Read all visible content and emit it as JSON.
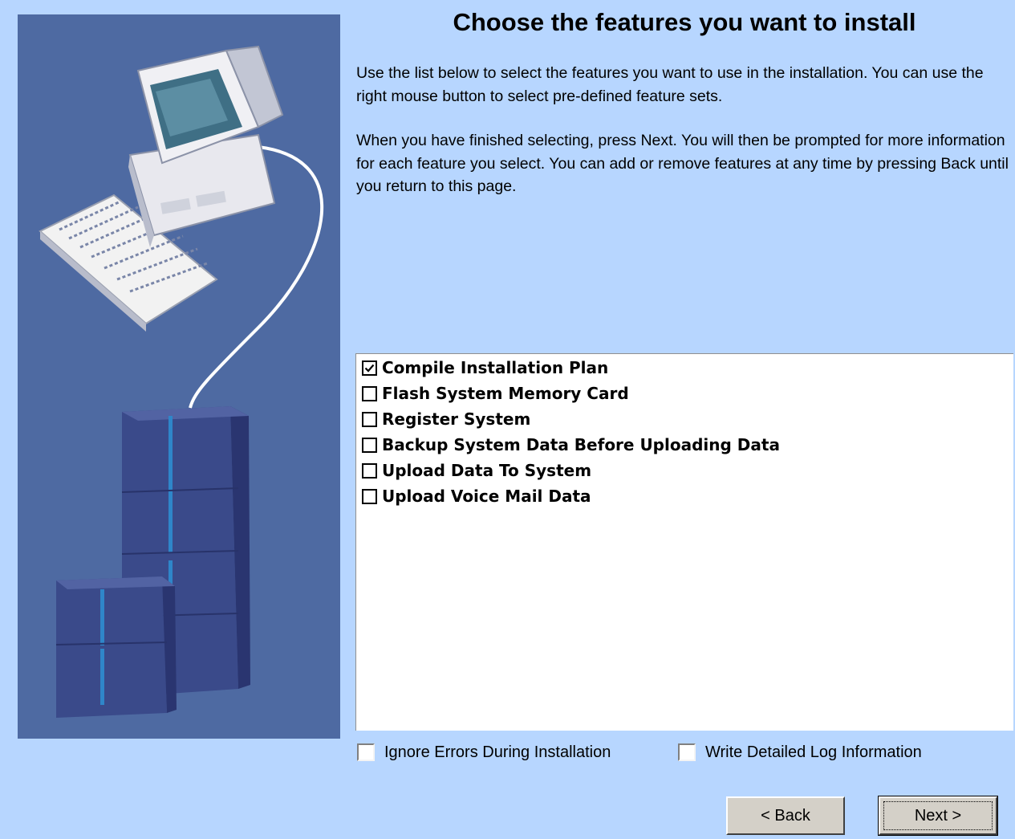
{
  "window": {
    "title": "Choose the features you want to install"
  },
  "description": {
    "paragraph1": "Use the list below to select the features you want to use in the installation. You can use the right mouse button to select pre-defined feature sets.",
    "paragraph2": "When you have finished selecting, press Next. You will then be prompted for more information for each feature you select. You can add or remove features at any time by pressing Back until you return to this page."
  },
  "features": [
    {
      "label": "Compile Installation Plan",
      "checked": true
    },
    {
      "label": "Flash System Memory Card",
      "checked": false
    },
    {
      "label": "Register System",
      "checked": false
    },
    {
      "label": "Backup System Data Before Uploading Data",
      "checked": false
    },
    {
      "label": "Upload Data To System",
      "checked": false
    },
    {
      "label": "Upload Voice Mail Data",
      "checked": false
    }
  ],
  "options": {
    "ignore_errors": {
      "label": "Ignore Errors During Installation",
      "checked": false
    },
    "detailed_log": {
      "label": "Write Detailed Log Information",
      "checked": false
    }
  },
  "buttons": {
    "back_label": "< Back",
    "next_label": "Next >"
  },
  "colors": {
    "background": "#b7d6ff",
    "illustration_background": "#4e6aa2",
    "button_face": "#d4d0c8"
  }
}
